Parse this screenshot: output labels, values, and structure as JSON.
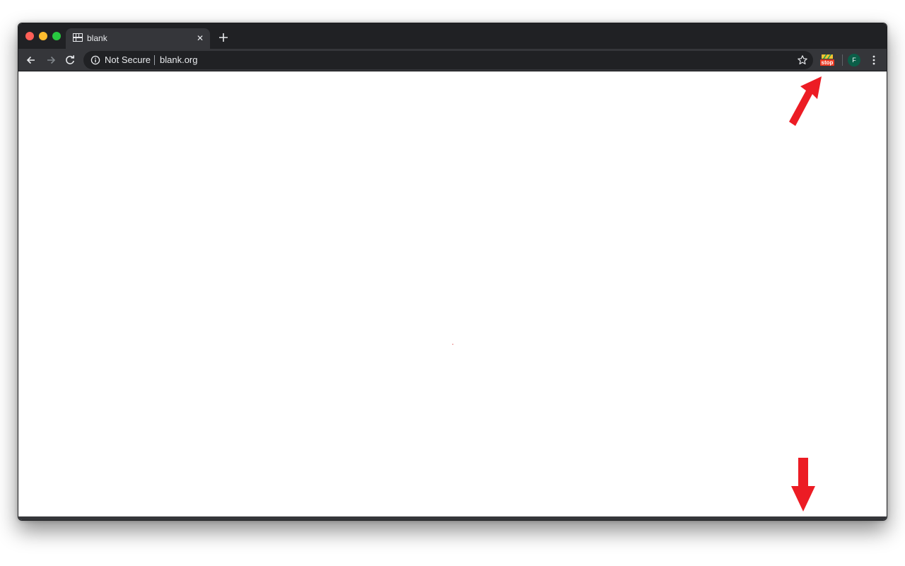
{
  "tab": {
    "title": "blank",
    "close_glyph": "✕",
    "favicon": "grid-favicon-icon"
  },
  "toolbar": {
    "security_label": "Not Secure",
    "url": "blank.org"
  },
  "extension": {
    "label": "stop",
    "accent_color": "#ec3a23"
  },
  "profile": {
    "initial": "F",
    "color": "#0b5e48"
  },
  "annotations": {
    "color": "#ec1c24"
  },
  "colors": {
    "chrome_dark": "#202124",
    "chrome_toolbar": "#35363a",
    "text_light": "#e8eaed"
  }
}
